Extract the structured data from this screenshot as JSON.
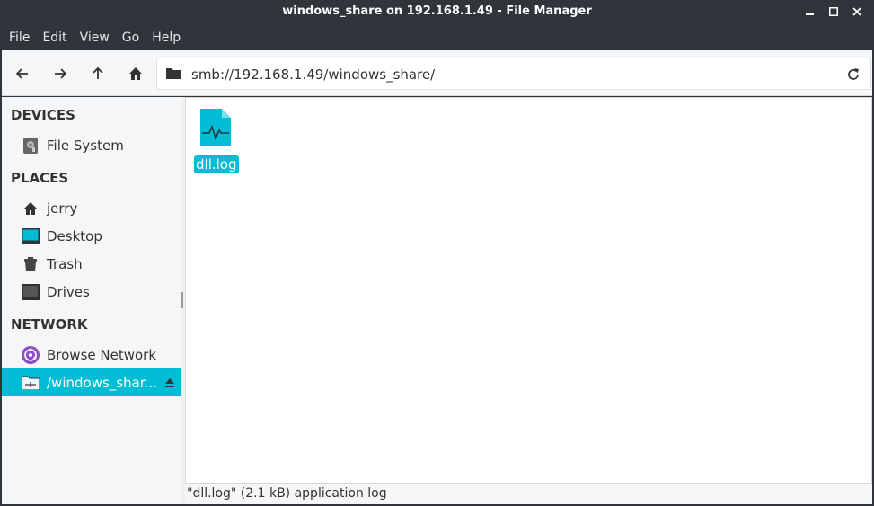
{
  "window": {
    "title": "windows_share on 192.168.1.49 - File Manager"
  },
  "menu": [
    "File",
    "Edit",
    "View",
    "Go",
    "Help"
  ],
  "toolbar": {
    "back_icon": "arrow-left-icon",
    "forward_icon": "arrow-right-icon",
    "up_icon": "arrow-up-icon",
    "home_icon": "home-icon",
    "location": "smb://192.168.1.49/windows_share/"
  },
  "sidebar": {
    "devices_heading": "DEVICES",
    "devices": [
      {
        "label": "File System",
        "icon": "harddisk-icon"
      }
    ],
    "places_heading": "PLACES",
    "places": [
      {
        "label": "jerry",
        "icon": "home-icon"
      },
      {
        "label": "Desktop",
        "icon": "desktop-icon"
      },
      {
        "label": "Trash",
        "icon": "trash-icon"
      },
      {
        "label": "Drives",
        "icon": "drive-icon"
      }
    ],
    "network_heading": "NETWORK",
    "network": [
      {
        "label": "Browse Network",
        "icon": "network-icon"
      },
      {
        "label": "/windows_shar...",
        "icon": "network-share-icon",
        "selected": true
      }
    ]
  },
  "files": [
    {
      "name": "dll.log",
      "icon": "log-file-icon",
      "selected": true
    }
  ],
  "status": "\"dll.log\" (2.1 kB) application log",
  "colors": {
    "accent": "#00bcd4",
    "titlebar": "#2f353b"
  }
}
